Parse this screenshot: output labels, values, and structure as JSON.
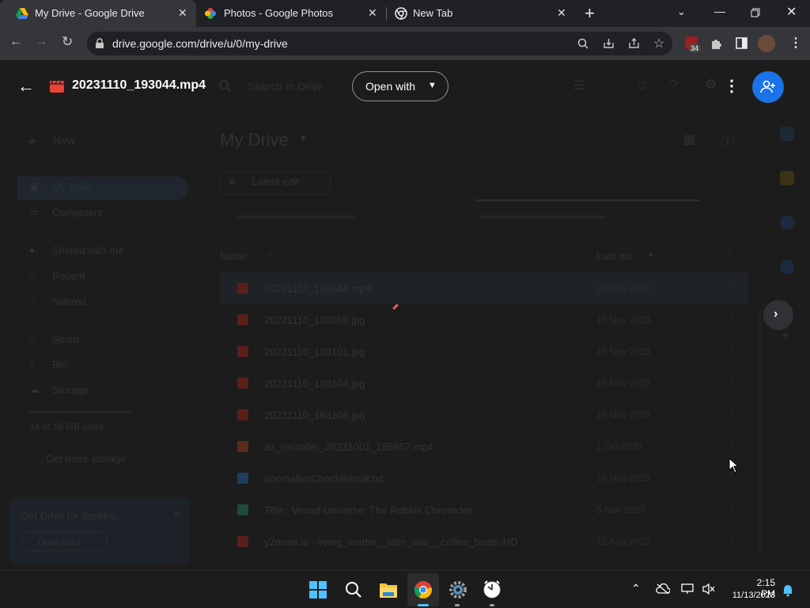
{
  "browser": {
    "tabs": [
      {
        "title": "My Drive - Google Drive",
        "icon": "google-drive-icon",
        "active": true
      },
      {
        "title": "Photos - Google Photos",
        "icon": "google-photos-icon",
        "active": false
      },
      {
        "title": "New Tab",
        "icon": "chrome-icon",
        "active": false
      }
    ],
    "new_tab_symbol": "+",
    "url": "drive.google.com/drive/u/0/my-drive",
    "extension_badge": "34"
  },
  "viewer": {
    "file_title": "20231110_193044.mp4",
    "open_with_label": "Open with"
  },
  "drive": {
    "new_label": "New",
    "search_placeholder": "Search in Drive",
    "page_title": "My Drive",
    "sidebar": [
      {
        "label": "My Drive",
        "icon": "drive-icon"
      },
      {
        "label": "Computers",
        "icon": "computer-icon"
      },
      {
        "label": "Shared with me",
        "icon": "people-icon"
      },
      {
        "label": "Recent",
        "icon": "clock-icon"
      },
      {
        "label": "Starred",
        "icon": "star-icon"
      },
      {
        "label": "Spam",
        "icon": "spam-icon"
      },
      {
        "label": "Bin",
        "icon": "trash-icon"
      },
      {
        "label": "Storage",
        "icon": "cloud-icon"
      }
    ],
    "storage_text": "14 of 15 GB used",
    "get_more_storage": "Get more storage",
    "promo_title": "Get Drive for desktop",
    "promo_button": "Download",
    "filter_chip": "Latest edit",
    "col_name": "Name",
    "col_modified": "Last mo...",
    "files": [
      {
        "name": "20231110_193044.mp4",
        "date": "10 Nov 2023",
        "color": "#5a1f1a"
      },
      {
        "name": "20231110_193059.jpg",
        "date": "10 Nov 2023",
        "color": "#5a1f1a"
      },
      {
        "name": "20231110_193101.jpg",
        "date": "10 Nov 2023",
        "color": "#5a1f1a"
      },
      {
        "name": "20231110_193104.jpg",
        "date": "10 Nov 2023",
        "color": "#5a1f1a"
      },
      {
        "name": "20231110_193108.jpg",
        "date": "10 Nov 2023",
        "color": "#5a1f1a"
      },
      {
        "name": "az_recorder_20231001_185957.mp4",
        "date": "1 Oct 2023",
        "color": "#5a2a1a"
      },
      {
        "name": "anomaliesCheckResult.txt",
        "date": "10 Nov 2023",
        "color": "#1f3f5a"
      },
      {
        "name": "Title : Vexed Universe: The Roblox Chronicles",
        "date": "5 Nov 2023",
        "color": "#1f4a3a"
      },
      {
        "name": "y2mate.is - irving_martin__latin_star__coffee_beats-HD",
        "date": "12 Aug 2023",
        "color": "#5a1f1a"
      }
    ]
  },
  "taskbar": {
    "time": "2:15 PM",
    "date": "11/13/2023"
  }
}
